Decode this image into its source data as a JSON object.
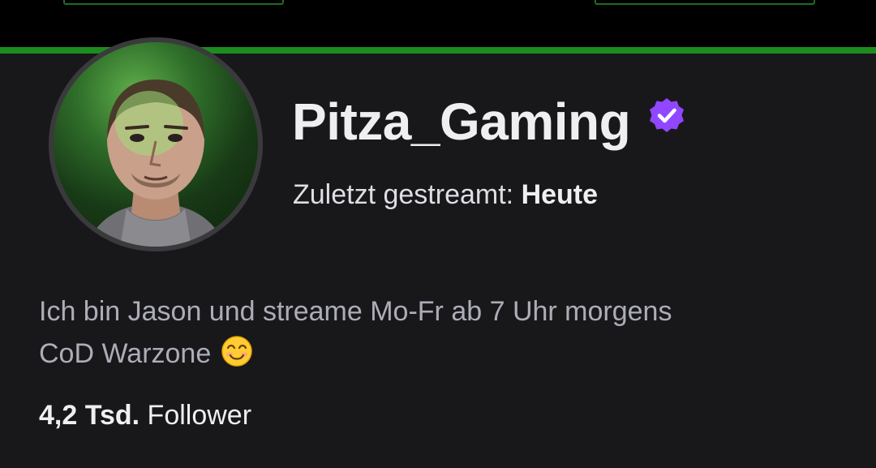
{
  "banner": {
    "accent_color": "#1d8c1f"
  },
  "profile": {
    "avatar_icon": "profile-avatar",
    "channel_name": "Pitza_Gaming",
    "verified_icon": "verified-badge-icon",
    "verified_color": "#9147ff",
    "last_streamed_label": "Zuletzt gestreamt:",
    "last_streamed_value": "Heute",
    "bio_line1": "Ich bin Jason und streame Mo-Fr ab 7 Uhr morgens",
    "bio_line2": "CoD Warzone",
    "bio_emoji": "smiling-face-emoji",
    "followers_count": "4,2 Tsd.",
    "followers_label": "Follower"
  }
}
